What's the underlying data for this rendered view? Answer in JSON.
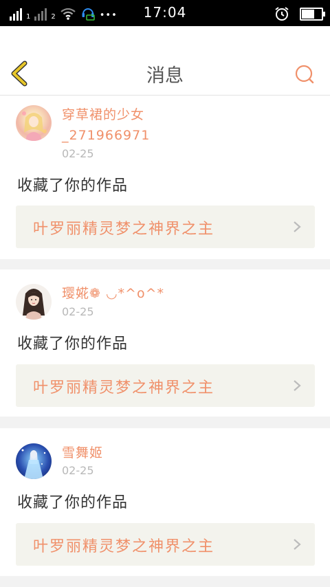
{
  "status_bar": {
    "sim1": "1",
    "sim2": "2",
    "more": "•••",
    "time": "17:04",
    "battery_level": 0.6
  },
  "header": {
    "title": "消息"
  },
  "messages": [
    {
      "user_name_line1": "穿草裙的少女",
      "user_name_line2": "_271966971",
      "date": "02-25",
      "action": "收藏了你的作品",
      "work_title": "叶罗丽精灵梦之神界之主"
    },
    {
      "user_name_line1": "璎婲❁ ◡*^o^*",
      "date": "02-25",
      "action": "收藏了你的作品",
      "work_title": "叶罗丽精灵梦之神界之主"
    },
    {
      "user_name_line1": "雪舞姬",
      "date": "02-25",
      "action": "收藏了你的作品",
      "work_title": "叶罗丽精灵梦之神界之主"
    }
  ],
  "colors": {
    "accent": "#f0906a",
    "back_arrow": "#e8c72a",
    "background": "#f2f2f2"
  },
  "icons": {
    "back": "back-arrow-icon",
    "search": "search-icon",
    "chevron": "chevron-right-icon",
    "alarm": "alarm-icon",
    "wifi": "wifi-icon",
    "battery": "battery-icon"
  }
}
